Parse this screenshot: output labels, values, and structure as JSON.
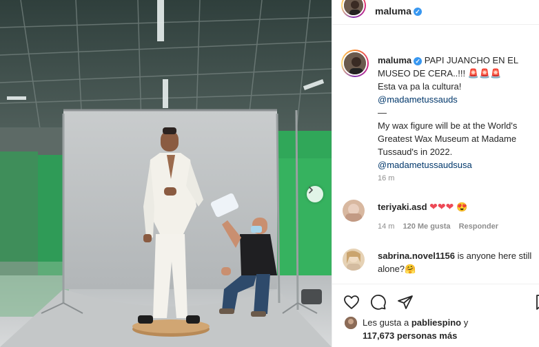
{
  "header": {
    "username": "maluma",
    "verified_mark": "✓"
  },
  "caption": {
    "username": "maluma",
    "verified_mark": "✓",
    "line1_text": "PAPI JUANCHO EN EL MUSEO DE CERA..!!!",
    "sirens": "🚨🚨🚨",
    "line2": "Esta va pa la cultura!",
    "mention1": "@madametussauds",
    "divider": "—",
    "line3": "My wax figure will be at the World's Greatest Wax Museum at Madame Tussaud's in 2022.",
    "mention2": "@madametussaudsusa",
    "time": "16 m"
  },
  "comments": [
    {
      "username": "teriyaki.asd",
      "text": "",
      "hearts": "❤❤❤",
      "emoji": "😍",
      "time": "14 m",
      "likes": "120 Me gusta",
      "reply": "Responder"
    },
    {
      "username": "sabrina.novel1156",
      "text": "is anyone here still alone?",
      "emoji": "🤗"
    }
  ],
  "likes": {
    "prefix": "Les gusta a",
    "user": "pabliespino",
    "suffix": "y",
    "count": "117,673 personas más"
  },
  "icons": [
    "chevron-right-icon",
    "heart-icon",
    "comment-icon",
    "share-icon",
    "bookmark-icon"
  ],
  "colors": {
    "accent": "#3897f0",
    "mention": "#00376b",
    "muted": "#8e8e8e",
    "heart": "#ed4956"
  }
}
